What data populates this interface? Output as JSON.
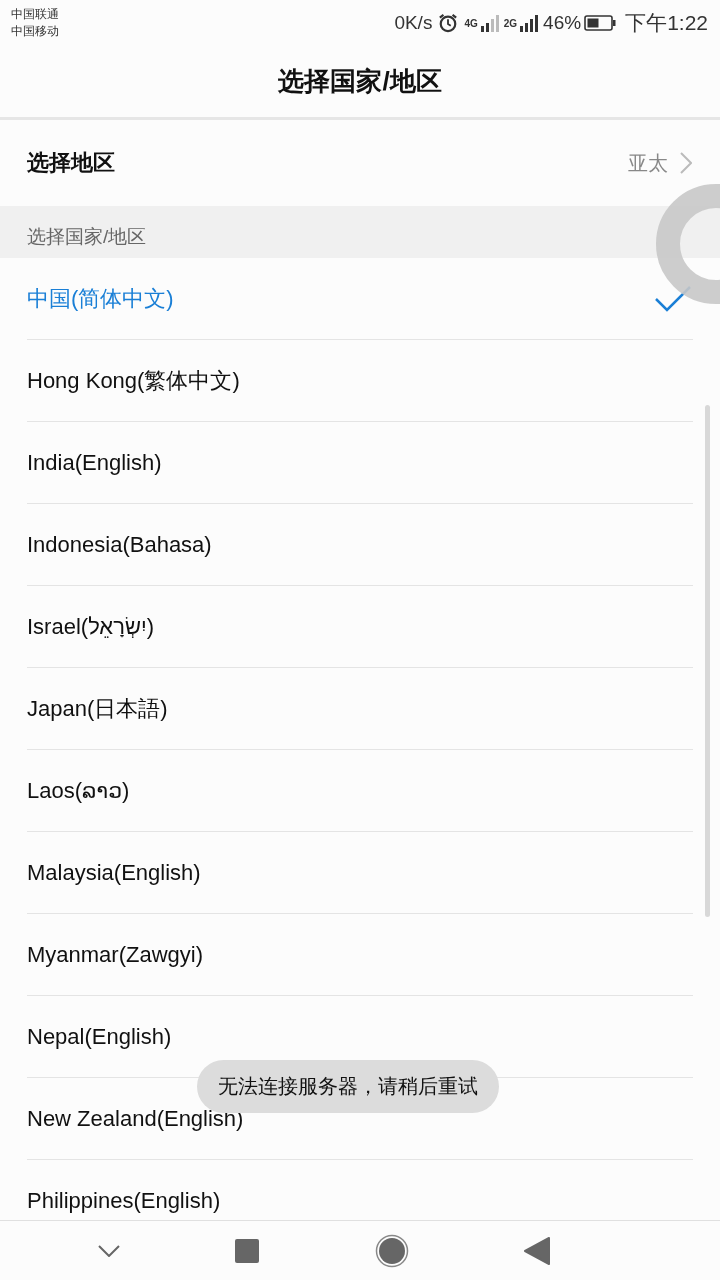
{
  "status_bar": {
    "carriers": [
      "中国联通",
      "中国移动"
    ],
    "speed": "0K/s",
    "sim1_network": "4G",
    "sim2_network": "2G",
    "battery": "46%",
    "time": "下午1:22"
  },
  "title": "选择国家/地区",
  "region": {
    "label": "选择地区",
    "value": "亚太"
  },
  "section_header": "选择国家/地区",
  "countries": [
    {
      "label": "中国(简体中文)",
      "selected": true
    },
    {
      "label": "Hong Kong(繁体中文)",
      "selected": false
    },
    {
      "label": "India(English)",
      "selected": false
    },
    {
      "label": "Indonesia(Bahasa)",
      "selected": false
    },
    {
      "label": "Israel(יִשְׂרָאֵל)",
      "selected": false
    },
    {
      "label": "Japan(日本語)",
      "selected": false
    },
    {
      "label": "Laos(ລາວ)",
      "selected": false
    },
    {
      "label": "Malaysia(English)",
      "selected": false
    },
    {
      "label": "Myanmar(Zawgyi)",
      "selected": false
    },
    {
      "label": "Nepal(English)",
      "selected": false
    },
    {
      "label": "New Zealand(English)",
      "selected": false
    },
    {
      "label": "Philippines(English)",
      "selected": false
    }
  ],
  "toast": "无法连接服务器，请稍后重试"
}
